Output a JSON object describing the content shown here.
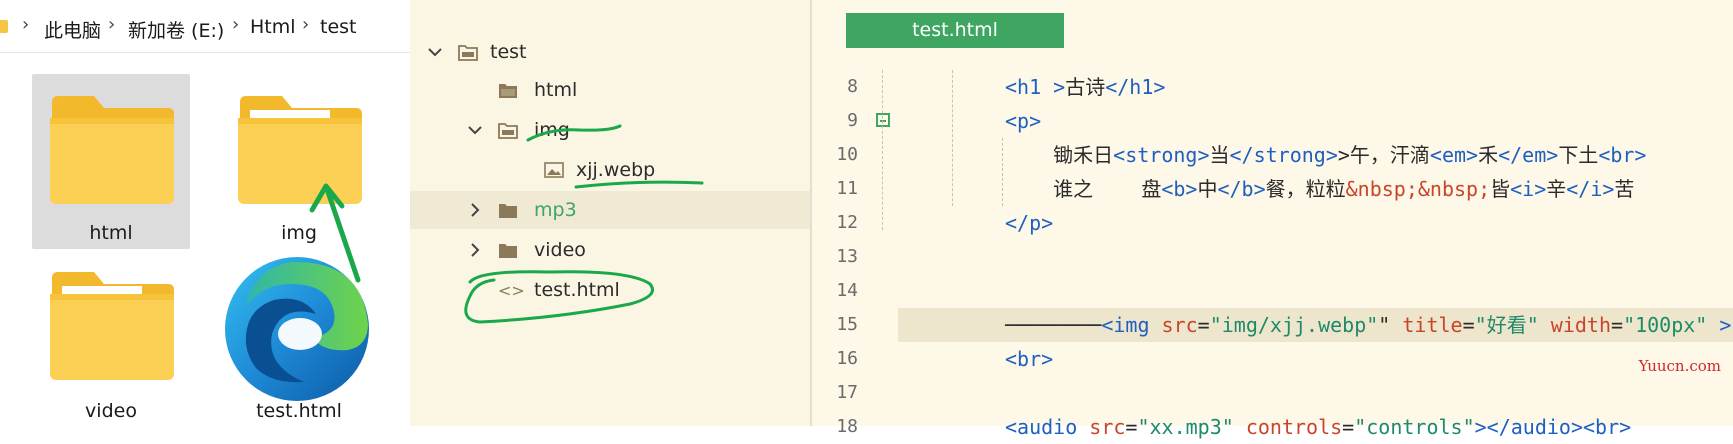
{
  "explorer": {
    "breadcrumb": [
      "此电脑",
      "新加卷 (E:)",
      "Html",
      "test"
    ],
    "breadcrumb_sep": "›",
    "items": [
      {
        "label": "html",
        "type": "folder",
        "selected": true
      },
      {
        "label": "img",
        "type": "folder",
        "selected": false
      },
      {
        "label": "video",
        "type": "folder",
        "selected": false
      },
      {
        "label": "test.html",
        "type": "edge-html-file",
        "selected": false
      }
    ]
  },
  "tree": {
    "root": "test",
    "items": [
      {
        "label": "html",
        "icon": "folder-icon"
      },
      {
        "label": "img",
        "icon": "folder-icon",
        "expanded": true
      },
      {
        "label": "xjj.webp",
        "icon": "image-icon"
      },
      {
        "label": "mp3",
        "icon": "folder-icon",
        "expanded": false
      },
      {
        "label": "video",
        "icon": "folder-icon",
        "expanded": false
      },
      {
        "label": "test.html",
        "icon": "code-icon"
      }
    ],
    "chevron_expanded": "⌄",
    "chevron_collapsed": "›",
    "code_glyph": "<>"
  },
  "editor": {
    "tab": "test.html",
    "lines": [
      {
        "n": "8",
        "parts": [
          [
            "tag",
            "<h1 >"
          ],
          [
            "txtc",
            "古诗"
          ],
          [
            "tag",
            "</h1>"
          ]
        ]
      },
      {
        "n": "9",
        "parts": [
          [
            "tag",
            "<p>"
          ]
        ]
      },
      {
        "n": "10",
        "parts": [
          [
            "txtc",
            "    锄禾日"
          ],
          [
            "tag",
            "<strong>"
          ],
          [
            "txtc",
            "当"
          ],
          [
            "tag",
            "</strong>"
          ],
          [
            "txtc",
            ">午，汗滴"
          ],
          [
            "tag",
            "<em>"
          ],
          [
            "txtc",
            "禾"
          ],
          [
            "tag",
            "</em>"
          ],
          [
            "txtc",
            "下土"
          ],
          [
            "tag",
            "<br>"
          ]
        ]
      },
      {
        "n": "11",
        "parts": [
          [
            "txtc",
            "    谁之    盘"
          ],
          [
            "tag",
            "<b>"
          ],
          [
            "txtc",
            "中"
          ],
          [
            "tag",
            "</b>"
          ],
          [
            "txtc",
            "餐，粒粒"
          ],
          [
            "ent",
            "&nbsp;&nbsp;"
          ],
          [
            "txtc",
            "皆"
          ],
          [
            "tag",
            "<i>"
          ],
          [
            "txtc",
            "辛"
          ],
          [
            "tag",
            "</i>"
          ],
          [
            "txtc",
            "苦"
          ]
        ]
      },
      {
        "n": "12",
        "parts": [
          [
            "tag",
            "</p>"
          ]
        ]
      },
      {
        "n": "13",
        "parts": []
      },
      {
        "n": "14",
        "parts": []
      },
      {
        "n": "15",
        "parts": [
          [
            "txtc",
            "────────"
          ],
          [
            "tag",
            "<img"
          ],
          [
            "txtc",
            " "
          ],
          [
            "attr",
            "src"
          ],
          [
            "txtc",
            "="
          ],
          [
            "str",
            "\"img/xjj.webp\""
          ],
          [
            "txtc",
            "\" "
          ],
          [
            "attr",
            "title"
          ],
          [
            "txtc",
            "="
          ],
          [
            "str",
            "\"好看\""
          ],
          [
            "txtc",
            " "
          ],
          [
            "attr",
            "width"
          ],
          [
            "txtc",
            "="
          ],
          [
            "str",
            "\"100px\""
          ],
          [
            "txtc",
            " "
          ],
          [
            "tag",
            ">"
          ]
        ]
      },
      {
        "n": "16",
        "parts": [
          [
            "tag",
            "<br>"
          ]
        ]
      },
      {
        "n": "17",
        "parts": []
      },
      {
        "n": "18",
        "parts": [
          [
            "tag",
            "<audio "
          ],
          [
            "attr",
            "src"
          ],
          [
            "txtc",
            "="
          ],
          [
            "str",
            "\"xx.mp3\""
          ],
          [
            "txtc",
            " "
          ],
          [
            "attr",
            "controls"
          ],
          [
            "txtc",
            "="
          ],
          [
            "str",
            "\"controls\""
          ],
          [
            "tag",
            "></audio><br>"
          ]
        ]
      }
    ],
    "watermark": "Yuucn.com"
  },
  "colors": {
    "accent": "#3ea661",
    "annotation": "#1aa84a",
    "tree_bg": "#fbf6e4",
    "editor_bg": "#fdf8e8"
  }
}
